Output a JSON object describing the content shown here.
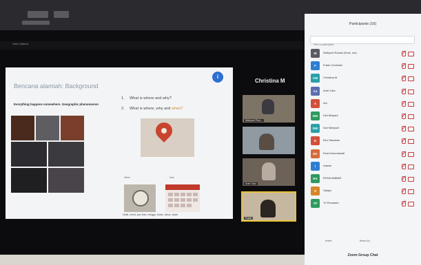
{
  "window": {
    "view_options": "View Options"
  },
  "slide": {
    "title": "Bencana alamiah: Background",
    "subtitle": "Everything happens somewhere. Geographic phenomenon",
    "questions": [
      {
        "num": "1.",
        "text": "What is where and why?",
        "highlight": ""
      },
      {
        "num": "2.",
        "text": "What is where, why and ",
        "highlight": "when?"
      }
    ],
    "when_label": "When",
    "time_label": "time",
    "caption": "Detik, menit, jam   Hari, minggu, bulan, tahun, abad",
    "info_icon": "i"
  },
  "speaker": {
    "name": "Christina M"
  },
  "thumbnails": [
    {
      "label": "Wahyuni Pusi..."
    },
    {
      "label": ""
    },
    {
      "label": "Arief Joko"
    },
    {
      "label": "Frank"
    }
  ],
  "panel": {
    "title": "Participants (16)",
    "search_placeholder": "Find a participant",
    "participants": [
      {
        "initials": "W",
        "name": "Wahyuni Rosani (Host, me)",
        "color": "#5a5a62"
      },
      {
        "initials": "F",
        "name": "Frank Correlate",
        "color": "#2f7fd1"
      },
      {
        "initials": "CM",
        "name": "Christina M",
        "color": "#2aa0a8"
      },
      {
        "initials": "AJ",
        "name": "Arief Joko",
        "color": "#5b6fb0"
      },
      {
        "initials": "A",
        "name": "Ani",
        "color": "#d4503a"
      },
      {
        "initials": "DM",
        "name": "Dwi Mulyani",
        "color": "#2f9a5e"
      },
      {
        "initials": "DW",
        "name": "Dwi Wahyuni",
        "color": "#2aa0a8"
      },
      {
        "initials": "E",
        "name": "Eko Siswanto",
        "color": "#d4503a"
      },
      {
        "initials": "EK",
        "name": "Ema Kusumawati",
        "color": "#d56a3a"
      },
      {
        "initials": "I",
        "name": "Irawan",
        "color": "#2f7fd1"
      },
      {
        "initials": "RA",
        "name": "ROSA AMBAR",
        "color": "#2f9a5e"
      },
      {
        "initials": "S",
        "name": "Sakiyo",
        "color": "#d8862a"
      },
      {
        "initials": "TP",
        "name": "Tri Purwanto",
        "color": "#2f9a5e"
      }
    ],
    "invite_label": "Invite",
    "more_label": "More (v)",
    "chat_title": "Zoom Group Chat"
  }
}
